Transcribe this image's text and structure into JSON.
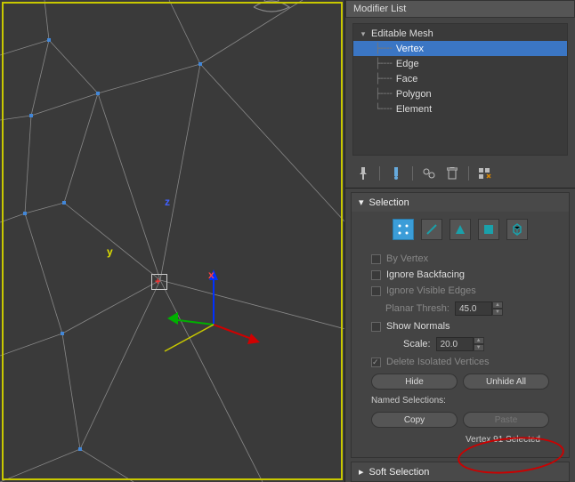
{
  "panel": {
    "modifier_list_label": "Modifier List",
    "modifier_tree": {
      "root": "Editable Mesh",
      "items": [
        "Vertex",
        "Edge",
        "Face",
        "Polygon",
        "Element"
      ],
      "selected": "Vertex"
    }
  },
  "selection": {
    "title": "Selection",
    "by_vertex": "By Vertex",
    "ignore_backfacing": "Ignore Backfacing",
    "ignore_visible_edges": "Ignore Visible Edges",
    "planar_thresh_label": "Planar Thresh:",
    "planar_thresh_value": "45.0",
    "show_normals": "Show Normals",
    "scale_label": "Scale:",
    "scale_value": "20.0",
    "delete_isolated": "Delete Isolated Vertices",
    "hide_btn": "Hide",
    "unhide_all_btn": "Unhide All",
    "named_selections": "Named Selections:",
    "copy_btn": "Copy",
    "paste_btn": "Paste",
    "status": "Vertex 91 Selected"
  },
  "soft_selection": {
    "title": "Soft Selection"
  },
  "axes": {
    "x": "x",
    "y": "y",
    "z": "z"
  },
  "icons": {
    "pin": "pin-icon",
    "config": "config-icon",
    "stack1": "stack-icon",
    "trash": "trash-icon",
    "grid": "grid-icon"
  }
}
